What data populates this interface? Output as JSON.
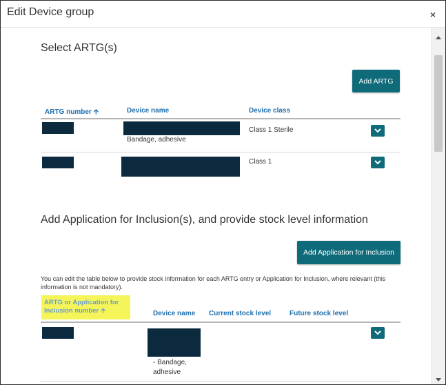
{
  "dialog": {
    "title": "Edit Device group",
    "close_glyph": "×"
  },
  "artg_section": {
    "heading": "Select ARTG(s)",
    "add_button": "Add ARTG",
    "columns": {
      "number": "ARTG number",
      "name": "Device name",
      "class": "Device class"
    },
    "rows": [
      {
        "device_name_extra": "Bandage, adhesive",
        "device_class": "Class 1 Sterile"
      },
      {
        "device_name_extra": "",
        "device_class": "Class 1"
      }
    ]
  },
  "application_section": {
    "heading": "Add Application for Inclusion(s), and provide stock level information",
    "add_button": "Add Application for Inclusion",
    "description": "You can edit the table below to provide stock information for each ARTG entry or Application for Inclusion, where relevant (this information is not mandatory).",
    "columns": {
      "number": "ARTG or Application for Inclusion number",
      "name": "Device name",
      "current": "Current stock level",
      "future": "Future stock level"
    },
    "rows": [
      {
        "device_name_extra": "- Bandage, adhesive"
      }
    ]
  },
  "colors": {
    "accent": "#0f6b7a",
    "link": "#1f6fae",
    "highlight": "#f5f55a",
    "redaction": "#0b2a3e"
  }
}
